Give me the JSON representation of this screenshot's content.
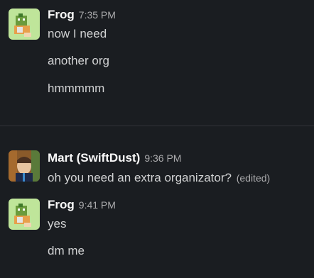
{
  "messages": [
    {
      "author": "Frog",
      "time": "7:35 PM",
      "lines": [
        "now I need",
        "another org",
        "hmmmmm"
      ]
    },
    {
      "author": "Mart (SwiftDust)",
      "time": "9:36 PM",
      "lines": [
        "oh you need an extra organizator?"
      ],
      "edited_label": "(edited)"
    },
    {
      "author": "Frog",
      "time": "9:41 PM",
      "lines": [
        "yes",
        "dm me"
      ]
    }
  ],
  "colors": {
    "background": "#1a1d21",
    "author": "#f8f8f8",
    "text": "#d1d2d3",
    "muted": "#ababad",
    "frog_avatar_bg": "#bfe59a"
  },
  "icons": {
    "frog_avatar": "frog-avatar",
    "mart_avatar": "user-photo-avatar"
  }
}
